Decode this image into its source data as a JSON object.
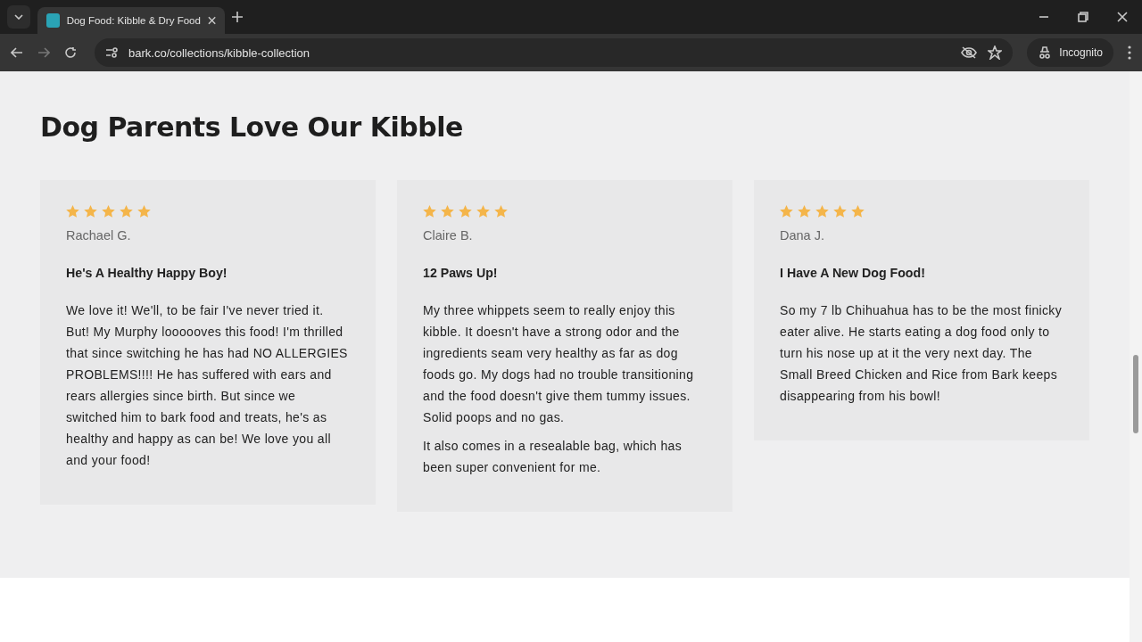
{
  "browser": {
    "tab_title": "Dog Food: Kibble & Dry Food",
    "url": "bark.co/collections/kibble-collection",
    "profile": "Incognito"
  },
  "section": {
    "heading": "Dog Parents Love Our Kibble",
    "reviews": [
      {
        "stars": 5,
        "author": "Rachael G.",
        "title": "He's A Healthy Happy Boy!",
        "paragraphs": [
          "We love it! We'll, to be fair I've never tried it. But! My Murphy loooooves this food! I'm thrilled that since switching he has had NO ALLERGIES PROBLEMS!!!! He has suffered with ears and rears allergies since birth. But since we switched him to bark food and treats, he's as healthy and happy as can be! We love you all and your food!"
        ]
      },
      {
        "stars": 5,
        "author": "Claire B.",
        "title": "12 Paws Up!",
        "paragraphs": [
          "My three whippets seem to really enjoy this kibble. It doesn't have a strong odor and the ingredients seam very healthy as far as dog foods go. My dogs had no trouble transitioning and the food doesn't give them tummy issues. Solid poops and no gas.",
          "It also comes in a resealable bag, which has been super convenient for me."
        ]
      },
      {
        "stars": 5,
        "author": "Dana J.",
        "title": "I Have A New Dog Food!",
        "paragraphs": [
          "So my 7 lb Chihuahua has to be the most finicky eater alive. He starts eating a dog food only to turn his nose up at it the very next day. The Small Breed Chicken and Rice from Bark keeps disappearing from his bowl!"
        ]
      }
    ]
  }
}
